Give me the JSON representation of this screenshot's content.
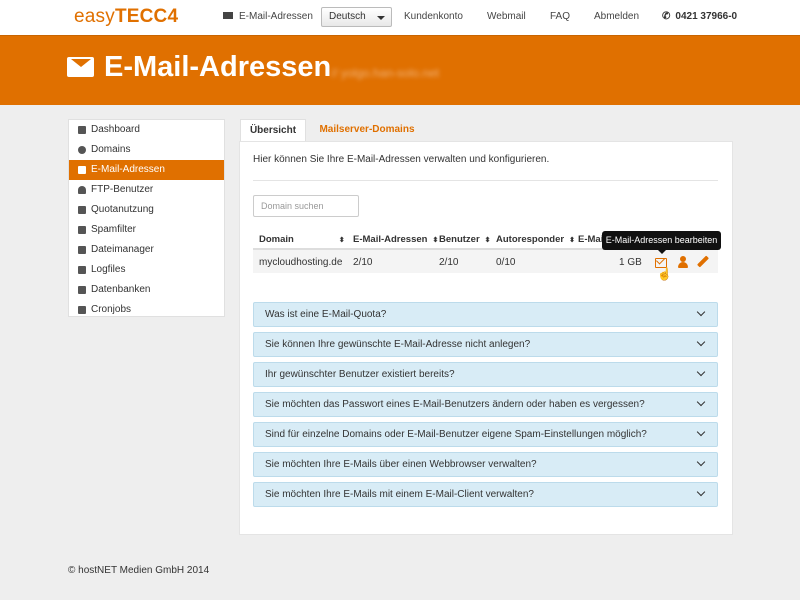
{
  "brand": {
    "easy": "easy",
    "tecc": "TECC4"
  },
  "topnav": {
    "email": "E-Mail-Adressen",
    "language": "Deutsch",
    "konto": "Kundenkonto",
    "webmail": "Webmail",
    "faq": "FAQ",
    "abmelden": "Abmelden",
    "phone": "0421 37966-0"
  },
  "banner": {
    "title": "E-Mail-Adressen",
    "subtitle": "// yolgo.han-solo.net"
  },
  "sidebar": {
    "items": [
      {
        "label": "Dashboard",
        "icon": "dashboard-icon"
      },
      {
        "label": "Domains",
        "icon": "globe-icon"
      },
      {
        "label": "E-Mail-Adressen",
        "icon": "envelope-icon",
        "active": true
      },
      {
        "label": "FTP-Benutzer",
        "icon": "user-icon"
      },
      {
        "label": "Quotanutzung",
        "icon": "drive-icon"
      },
      {
        "label": "Spamfilter",
        "icon": "filter-icon"
      },
      {
        "label": "Dateimanager",
        "icon": "folder-icon"
      },
      {
        "label": "Logfiles",
        "icon": "list-icon"
      },
      {
        "label": "Datenbanken",
        "icon": "database-icon"
      },
      {
        "label": "Cronjobs",
        "icon": "rocket-icon"
      }
    ]
  },
  "tabs": [
    {
      "label": "Übersicht",
      "active": true
    },
    {
      "label": "Mailserver-Domains",
      "active": false
    }
  ],
  "main": {
    "intro": "Hier können Sie Ihre E-Mail-Adressen verwalten und konfigurieren.",
    "search_placeholder": "Domain suchen",
    "columns": [
      "Domain",
      "E-Mail-Adressen",
      "Benutzer",
      "Autoresponder",
      "E-Mai"
    ],
    "row": {
      "domain": "mycloudhosting.de",
      "emails": "2/10",
      "users": "2/10",
      "autoresponder": "0/10",
      "quota": "1 GB"
    },
    "tooltip": "E-Mail-Adressen bearbeiten"
  },
  "faq": [
    "Was ist eine E-Mail-Quota?",
    "Sie können Ihre gewünschte E-Mail-Adresse nicht anlegen?",
    "Ihr gewünschter Benutzer existiert bereits?",
    "Sie möchten das Passwort eines E-Mail-Benutzers ändern oder haben es vergessen?",
    "Sind für einzelne Domains oder E-Mail-Benutzer eigene Spam-Einstellungen möglich?",
    "Sie möchten Ihre E-Mails über einen Webbrowser verwalten?",
    "Sie möchten Ihre E-Mails mit einem E-Mail-Client verwalten?"
  ],
  "footer": "© hostNET Medien GmbH 2014",
  "colors": {
    "accent": "#e07000",
    "faq_bg": "#d8ecf6",
    "page_bg": "#eeeeee"
  }
}
